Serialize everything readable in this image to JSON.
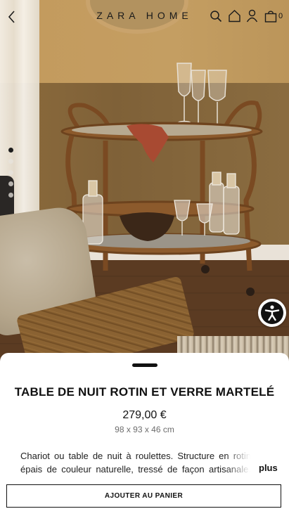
{
  "header": {
    "logo": "ZARA HOME",
    "bag_count": "0"
  },
  "icons": {
    "back": "chevron-left-icon",
    "search": "search-icon",
    "home": "home-icon",
    "user": "user-icon",
    "bag": "bag-icon",
    "accessibility": "accessibility-icon"
  },
  "gallery": {
    "image_count": 5,
    "active_index": 0
  },
  "product": {
    "title": "TABLE DE NUIT ROTIN ET VERRE MARTELÉ",
    "price": "279,00 €",
    "dimensions": "98 x 93 x 46 cm",
    "description": "Chariot ou table de nuit à roulettes. Structure en rotin épais de couleur naturelle, tressé de façon artisanale. Comp",
    "more_label": "plus",
    "add_to_cart_label": "AJOUTER AU PANIER"
  },
  "colors": {
    "accent": "#111111",
    "background": "#ffffff",
    "muted_text": "#6d6d6d"
  }
}
